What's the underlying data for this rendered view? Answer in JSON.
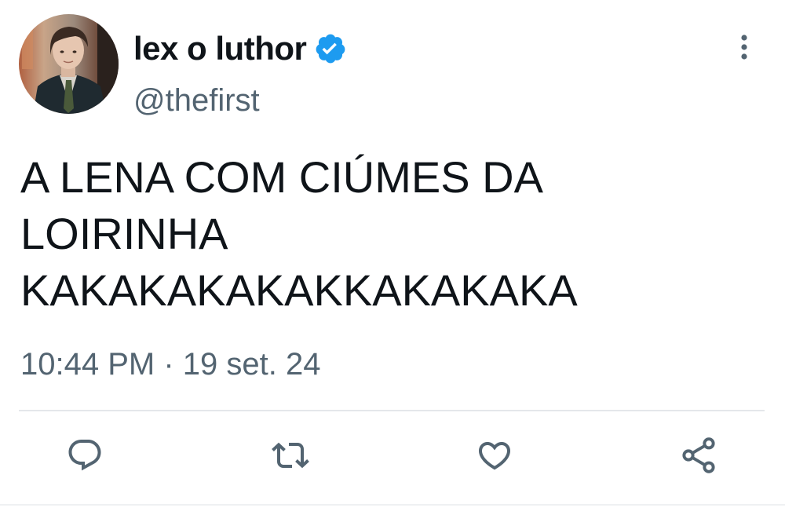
{
  "tweet": {
    "author": {
      "display_name": "lex o luthor",
      "handle": "@thefirst",
      "verified": true,
      "avatar_icon": "profile-photo"
    },
    "text": "A LENA COM CIÚMES DA\nLOIRINHA\nKAKAKAKAKAKKAKAKAKA",
    "timestamp": "10:44 PM · 19 set. 24",
    "menu_icon": "more-vertical-icon"
  },
  "actions": [
    {
      "name": "reply",
      "icon": "comment-icon"
    },
    {
      "name": "retweet",
      "icon": "retweet-icon"
    },
    {
      "name": "like",
      "icon": "heart-icon"
    },
    {
      "name": "share",
      "icon": "share-icon"
    }
  ],
  "colors": {
    "text_primary": "#0f1419",
    "text_secondary": "#536471",
    "verified_blue": "#1d9bf0",
    "divider": "#e4e7ea"
  }
}
